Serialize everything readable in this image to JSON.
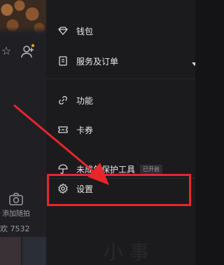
{
  "background": {
    "camera_label": "添加随拍",
    "count_text": "欢 7532",
    "icons": [
      "star-icon",
      "add-user-icon",
      "camera-icon"
    ]
  },
  "drawer": {
    "items": [
      {
        "label": "钱包",
        "icon": "wallet-icon"
      },
      {
        "label": "服务及订单",
        "icon": "order-list-icon"
      },
      {
        "label": "功能",
        "icon": "link-icon"
      },
      {
        "label": "卡券",
        "icon": "ticket-icon"
      },
      {
        "label": "未成年保护工具",
        "icon": "umbrella-icon",
        "badge": "已开启"
      },
      {
        "label": "设置",
        "icon": "gear-icon"
      }
    ]
  },
  "annotation": {
    "color": "#e8262c",
    "highlighted_item": "设置"
  }
}
